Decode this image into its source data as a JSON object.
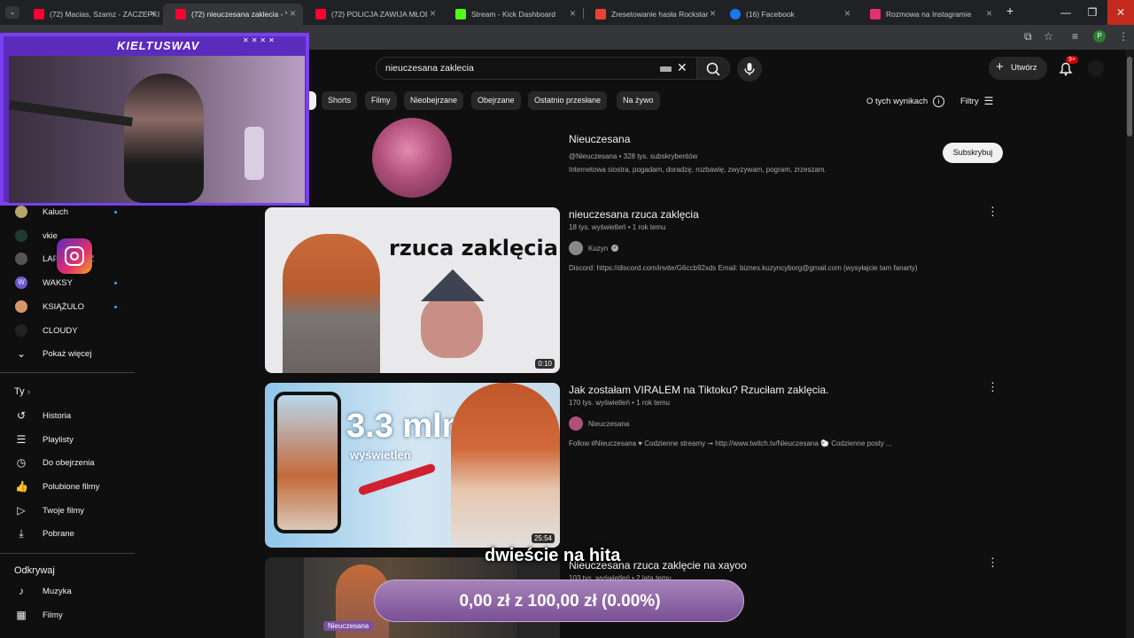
{
  "browser": {
    "tabs": [
      {
        "title": "(72) Macias, Szamz - ZACZEPKI",
        "color": "#ff0033"
      },
      {
        "title": "(72) nieuczesana zaklecia - YouTube",
        "color": "#ff0033"
      },
      {
        "title": "(72) POLICJA ZAWIJA MŁODEGO",
        "color": "#ff0033"
      },
      {
        "title": "Stream - Kick Dashboard",
        "color": "#53fc18"
      },
      {
        "title": "Zresetowanie hasła Rockstar Ga",
        "color": "#ea4335"
      },
      {
        "title": "(16) Facebook",
        "color": "#1877f2"
      },
      {
        "title": "Rozmowa na Instagramie",
        "color": "#e1306c"
      }
    ],
    "new_tab": "+",
    "window_buttons": [
      "—",
      "❐",
      "✕"
    ]
  },
  "overlay": {
    "streamer_name": "KIELTUSWAV",
    "donation_message": "dwieście na hita",
    "goal_text": "0,00 zł z 100,00 zł (0.00%)",
    "goal_fraction": 0.0
  },
  "header": {
    "search_value": "nieuczesana zaklecia",
    "create_label": "Utwórz",
    "notif_badge": "9+"
  },
  "chips": [
    "Shorts",
    "Filmy",
    "Nieobejrzane",
    "Obejrzane",
    "Ostatnio przesłane",
    "Na żywo"
  ],
  "about_results": "O tych wynikach",
  "filters_label": "Filtry",
  "sidebar": {
    "subscriptions": [
      {
        "label": "Kaluch",
        "dot": true
      },
      {
        "label": "vkie",
        "dot": false
      },
      {
        "label": "LAPSUS BEZ",
        "dot": false
      },
      {
        "label": "WAKSY",
        "dot": true
      },
      {
        "label": "KSIĄŻULO",
        "dot": true
      },
      {
        "label": "CLOUDY",
        "dot": false
      }
    ],
    "show_more": "Pokaż więcej",
    "you_heading": "Ty",
    "you_items": [
      "Historia",
      "Playlisty",
      "Do obejrzenia",
      "Polubione filmy",
      "Twoje filmy",
      "Pobrane"
    ],
    "explore_heading": "Odkrywaj",
    "explore_items": [
      "Muzyka",
      "Filmy"
    ]
  },
  "channel": {
    "name": "Nieuczesana",
    "meta": "@Nieuczesana • 328 tys. subskrybentów",
    "desc": "Internetowa siostra, pogadam, doradzę, rozbawię, zwyzywam, pogram, zrzeszam.",
    "subscribe": "Subskrybuj"
  },
  "videos": [
    {
      "title": "nieuczesana rzuca zaklęcia",
      "meta": "18 tys. wyświetleń • 1 rok temu",
      "channel": "Kuzyn",
      "desc": "Discord: https://discord.com/invite/G6ccb92xds Email: biznes.kuzyncyborg@gmail.com (wysyłajcie tam fanarty)",
      "duration": "0:10",
      "thumb_text": "rzuca zaklęcia"
    },
    {
      "title": "Jak zostałam VIRALEM na Tiktoku? Rzuciłam zaklęcia.",
      "meta": "170 tys. wyświetleń • 1 rok temu",
      "channel": "Nieuczesana",
      "desc": "Follow #Nieuczesana ♥ Codzienne streamy ➞ http://www.twitch.tv/Nieuczesana 🐑 Codzienne posty ...",
      "duration": "25:54",
      "thumb_big": "3.3 mln",
      "thumb_small": "wyświetleń"
    },
    {
      "title": "Nieuczesana rzuca zaklęcie na xayoo",
      "meta": "103 tys. wyświetleń • 2 lata temu",
      "thumb_label": "Nieuczesana"
    }
  ]
}
